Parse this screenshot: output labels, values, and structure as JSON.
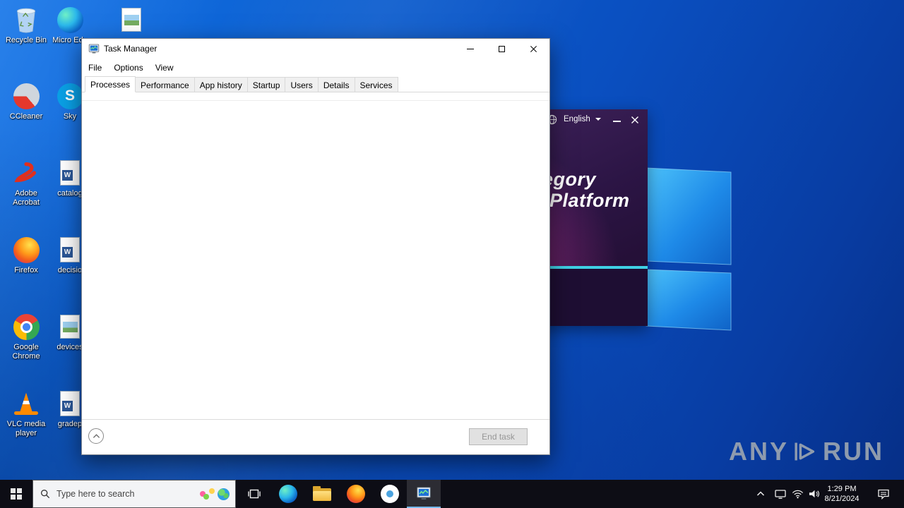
{
  "colors": {
    "wallpaper_blue": "#0a4fc0",
    "taskbar": "#0d0d15",
    "installer_accent": "#3fd0e4",
    "word_blue": "#2b5797",
    "acrobat_red": "#e02f1e"
  },
  "desktop": {
    "column1": [
      {
        "label": "Recycle Bin",
        "icon": "recycle-bin"
      },
      {
        "label": "CCleaner",
        "icon": "ccleaner"
      },
      {
        "label": "Adobe Acrobat",
        "icon": "adobe-acrobat"
      },
      {
        "label": "Firefox",
        "icon": "firefox"
      },
      {
        "label": "Google Chrome",
        "icon": "google-chrome"
      },
      {
        "label": "VLC media player",
        "icon": "vlc"
      }
    ],
    "column2": [
      {
        "label": "Micro Edg",
        "icon": "microsoft-edge"
      },
      {
        "label": "Sky",
        "icon": "skype"
      },
      {
        "label": "catalog",
        "icon": "word-document"
      },
      {
        "label": "decisio",
        "icon": "word-document"
      },
      {
        "label": "devices",
        "icon": "picture-file"
      },
      {
        "label": "gradep",
        "icon": "word-document"
      }
    ],
    "extra_icon": {
      "icon": "picture-file",
      "label": ""
    }
  },
  "glyphs": {
    "word_badge": "W",
    "skype_letter": "S"
  },
  "task_manager": {
    "title": "Task Manager",
    "menu": [
      "File",
      "Options",
      "View"
    ],
    "tabs": [
      "Processes",
      "Performance",
      "App history",
      "Startup",
      "Users",
      "Details",
      "Services"
    ],
    "active_tab": "Processes",
    "end_task_label": "End task"
  },
  "installer_window": {
    "language": "English",
    "headline1": "egory",
    "headline2": "Platform"
  },
  "taskbar": {
    "search_placeholder": "Type here to search",
    "time": "1:29 PM",
    "date": "8/21/2024"
  },
  "watermark": {
    "left": "ANY",
    "right": "RUN"
  }
}
